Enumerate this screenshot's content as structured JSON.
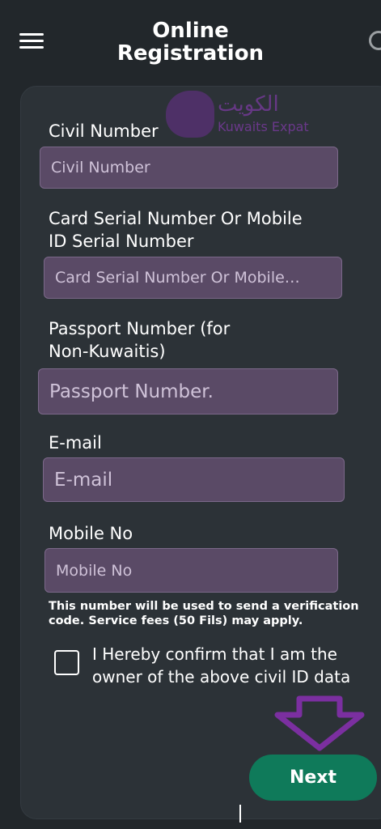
{
  "header": {
    "title_line1": "Online",
    "title_line2": "Registration",
    "menu_icon": "hamburger-menu-icon",
    "settings_icon": "gear-icon"
  },
  "watermark": {
    "arabic": "الكويت",
    "latin": "Kuwaits Expat"
  },
  "form": {
    "civil_number": {
      "label": "Civil Number",
      "placeholder": "Civil Number",
      "value": ""
    },
    "card_serial": {
      "label_line1": "Card Serial Number Or Mobile",
      "label_line2": "ID Serial Number",
      "placeholder": "Card Serial Number Or Mobile…",
      "value": ""
    },
    "passport": {
      "label_line1": "Passport Number (for",
      "label_line2": "Non-Kuwaitis)",
      "placeholder": "Passport Number.",
      "value": ""
    },
    "email": {
      "label": "E-mail",
      "placeholder": "E-mail",
      "value": ""
    },
    "mobile": {
      "label": "Mobile No",
      "placeholder": "Mobile No",
      "value": ""
    },
    "mobile_note_line1": "This number will be used to send a verification",
    "mobile_note_line2": "code. Service fees (50 Fils) may apply.",
    "confirm": {
      "label_line1": "I Hereby confirm that I am the",
      "label_line2": "owner of the above civil ID data",
      "checked": false
    }
  },
  "actions": {
    "next_label": "Next",
    "arrow_color": "#7b2fa0",
    "button_color": "#0f7a5a"
  }
}
